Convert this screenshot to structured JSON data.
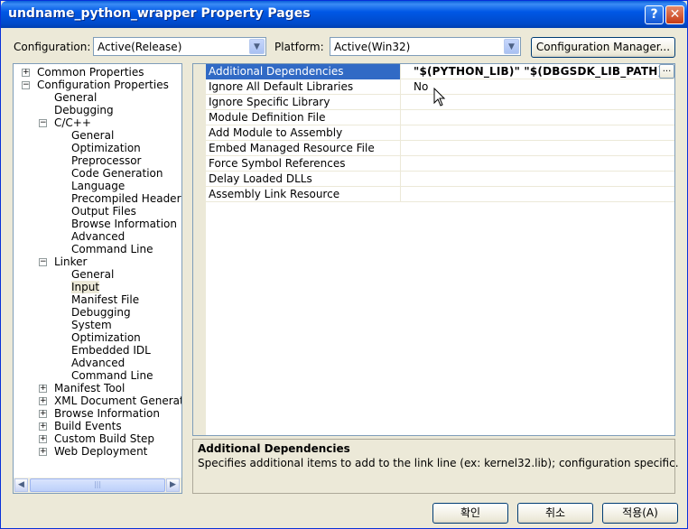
{
  "window": {
    "title": "undname_python_wrapper Property Pages",
    "help_glyph": "?",
    "close_glyph": "✕"
  },
  "config": {
    "configuration_label": "Configuration:",
    "configuration_value": "Active(Release)",
    "platform_label": "Platform:",
    "platform_value": "Active(Win32)",
    "manager_button": "Configuration Manager..."
  },
  "tree": {
    "common_properties": "Common Properties",
    "configuration_properties": "Configuration Properties",
    "general": "General",
    "debugging": "Debugging",
    "cpp": "C/C++",
    "cpp_items": [
      "General",
      "Optimization",
      "Preprocessor",
      "Code Generation",
      "Language",
      "Precompiled Headers",
      "Output Files",
      "Browse Information",
      "Advanced",
      "Command Line"
    ],
    "linker": "Linker",
    "linker_items": [
      "General",
      "Input",
      "Manifest File",
      "Debugging",
      "System",
      "Optimization",
      "Embedded IDL",
      "Advanced",
      "Command Line"
    ],
    "tail_items": [
      "Manifest Tool",
      "XML Document Generator",
      "Browse Information",
      "Build Events",
      "Custom Build Step",
      "Web Deployment"
    ],
    "selected": "Input"
  },
  "properties": [
    {
      "name": "Additional Dependencies",
      "value": "\"$(PYTHON_LIB)\" \"$(DBGSDK_LIB_PATH)₩i",
      "selected": true,
      "bold": true
    },
    {
      "name": "Ignore All Default Libraries",
      "value": "No"
    },
    {
      "name": "Ignore Specific Library",
      "value": ""
    },
    {
      "name": "Module Definition File",
      "value": ""
    },
    {
      "name": "Add Module to Assembly",
      "value": ""
    },
    {
      "name": "Embed Managed Resource File",
      "value": ""
    },
    {
      "name": "Force Symbol References",
      "value": ""
    },
    {
      "name": "Delay Loaded DLLs",
      "value": ""
    },
    {
      "name": "Assembly Link Resource",
      "value": ""
    }
  ],
  "ellipsis_button": "...",
  "description": {
    "title": "Additional Dependencies",
    "text": "Specifies additional items to add to the link line (ex: kernel32.lib); configuration specific."
  },
  "buttons": {
    "ok": "확인",
    "cancel": "취소",
    "apply": "적용(A)"
  },
  "icons": {
    "expand": "plus-icon",
    "collapse": "minus-icon",
    "dropdown": "chevron-down-icon",
    "cursor": "mouse-pointer-icon"
  },
  "colors": {
    "titlebar": "#0058e6",
    "selection": "#316ac5",
    "face": "#ece9d8"
  }
}
